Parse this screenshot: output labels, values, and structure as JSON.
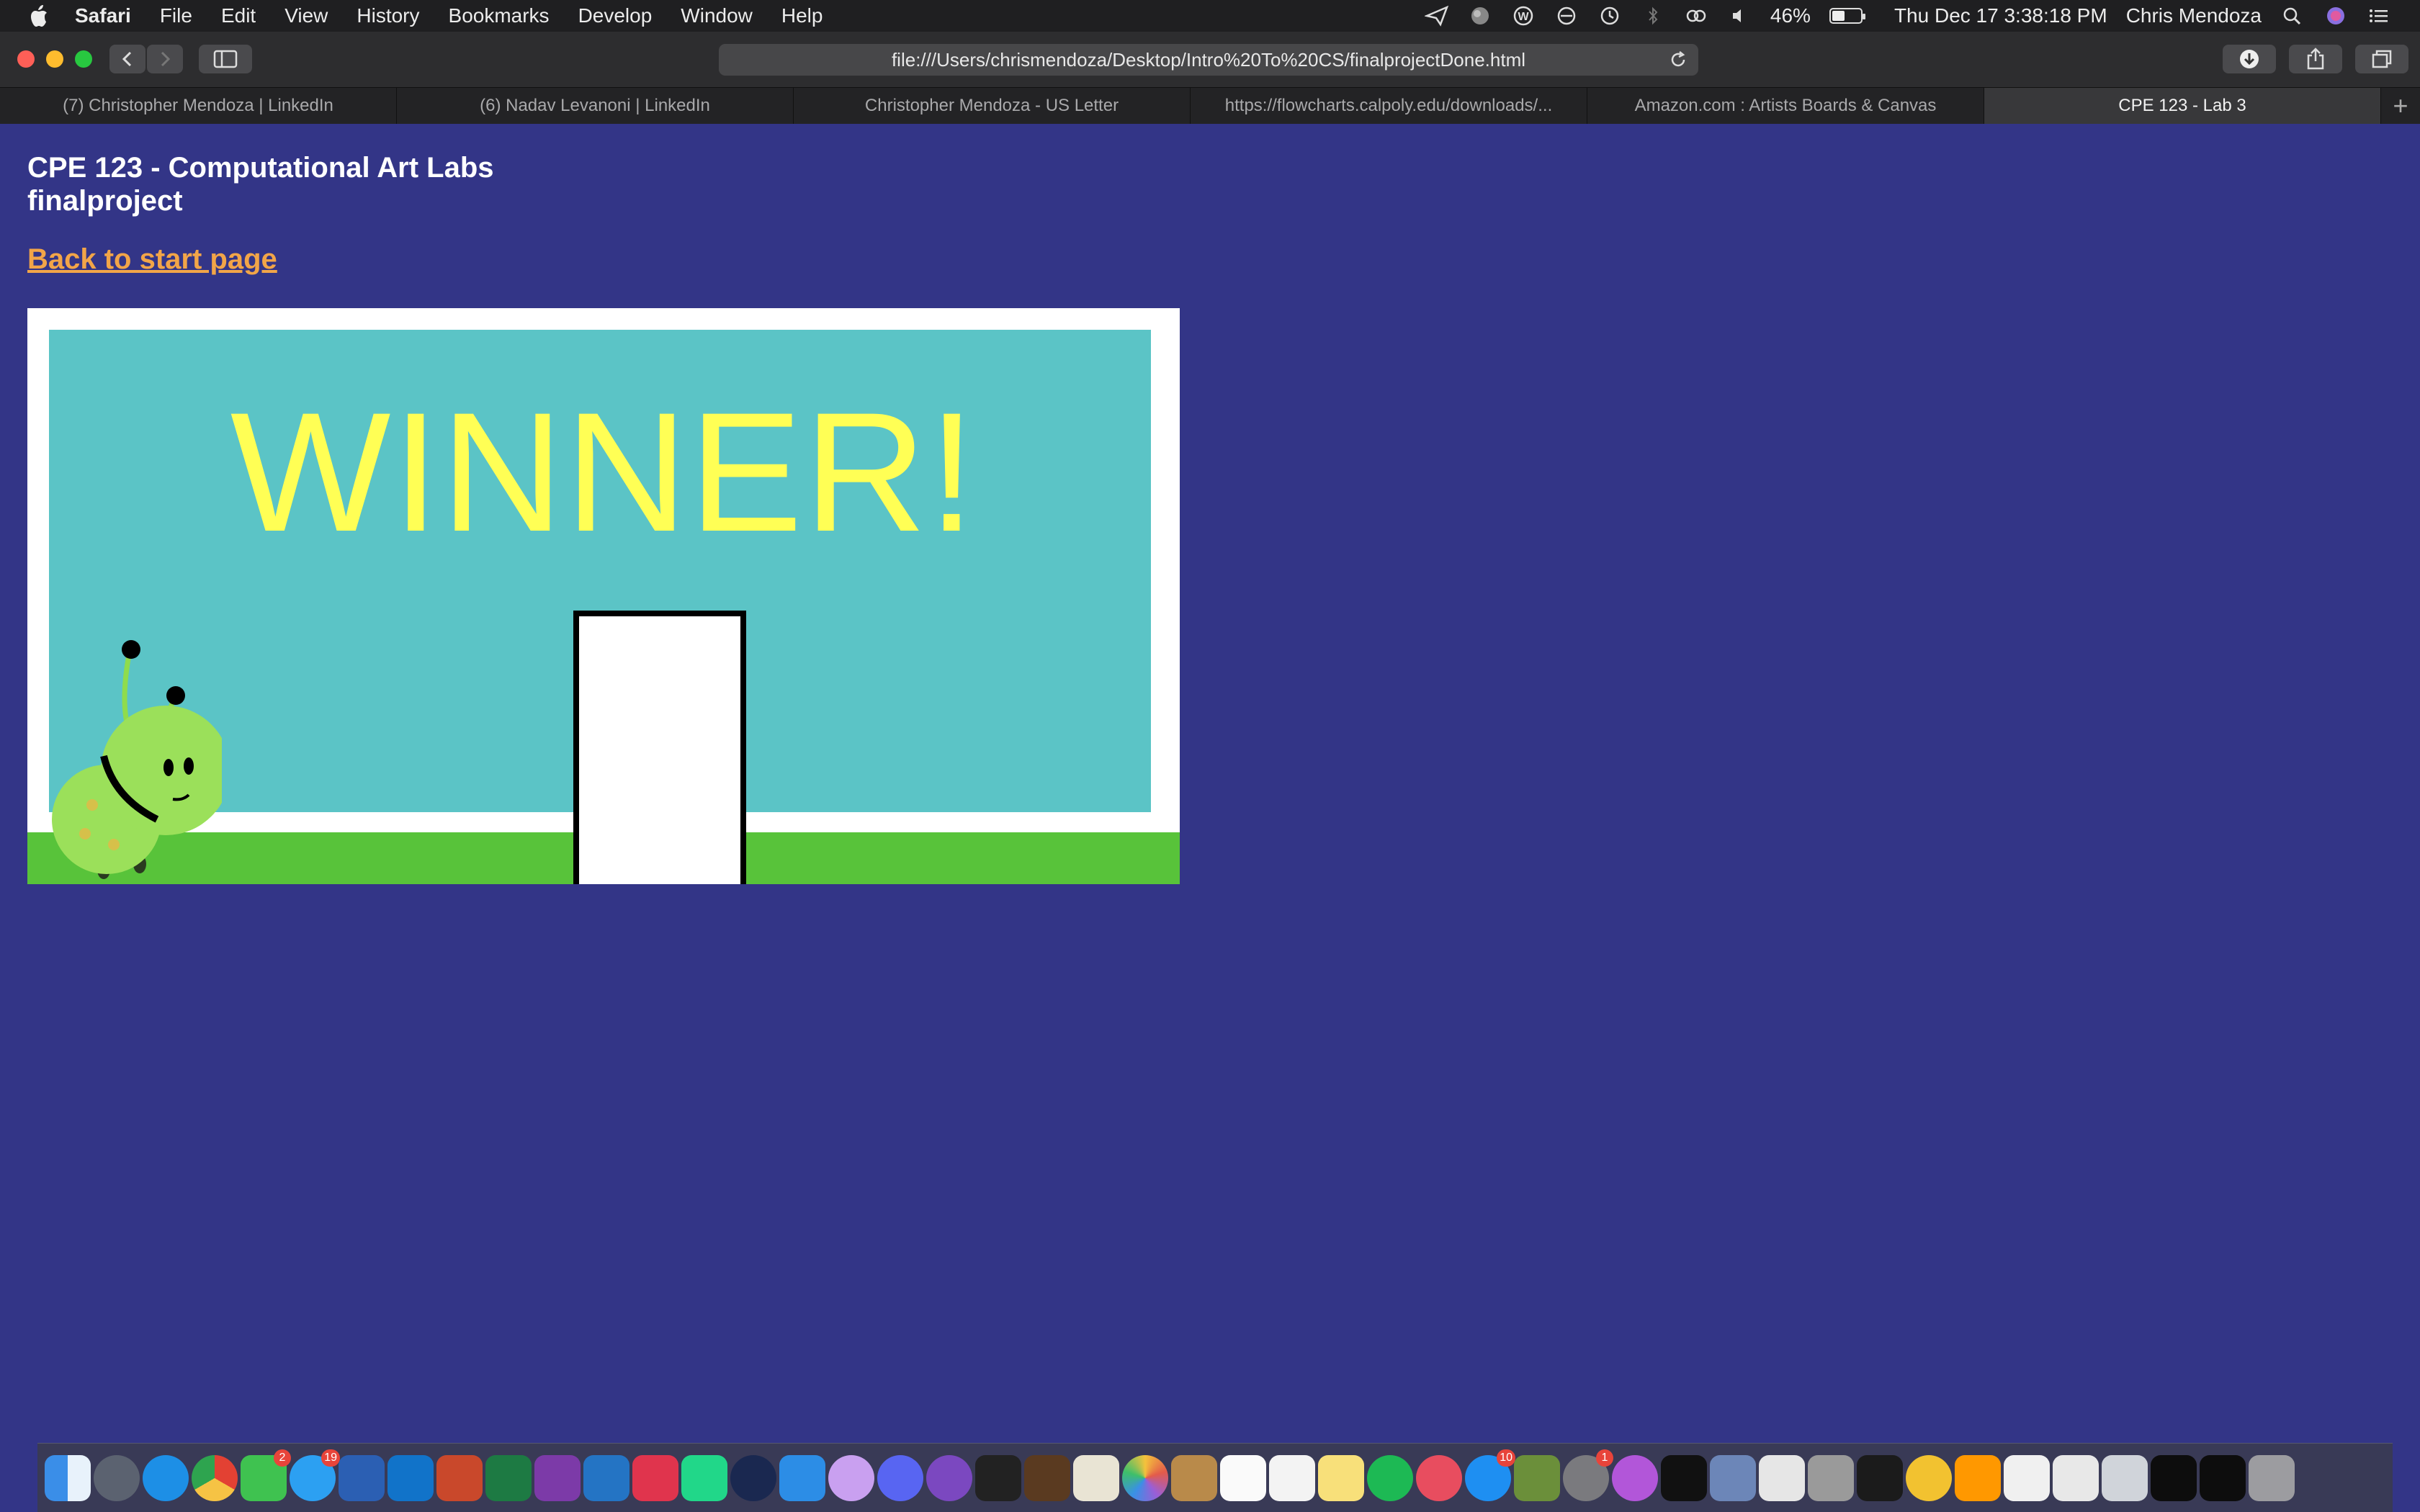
{
  "menubar": {
    "app": "Safari",
    "items": [
      "File",
      "Edit",
      "View",
      "History",
      "Bookmarks",
      "Develop",
      "Window",
      "Help"
    ],
    "battery": "46%",
    "battery_level": 0.46,
    "datetime": "Thu Dec 17  3:38:18 PM",
    "user": "Chris Mendoza"
  },
  "toolbar": {
    "url": "file:///Users/chrismendoza/Desktop/Intro%20To%20CS/finalprojectDone.html"
  },
  "tabs": [
    {
      "label": "(7) Christopher Mendoza | LinkedIn"
    },
    {
      "label": "(6) Nadav Levanoni | LinkedIn"
    },
    {
      "label": "Christopher Mendoza - US Letter"
    },
    {
      "label": "https://flowcharts.calpoly.edu/downloads/..."
    },
    {
      "label": "Amazon.com : Artists Boards & Canvas"
    },
    {
      "label": "CPE 123 - Lab 3"
    }
  ],
  "page": {
    "title_line1": "CPE 123 - Computational Art Labs",
    "title_line2": "finalproject",
    "back_link": "Back to start page",
    "canvas_text": "WINNER!"
  },
  "colors": {
    "page_bg": "#333587",
    "link": "#f2a548",
    "sky": "#5bc4c6",
    "grass": "#58c33a",
    "winner_text": "#ffff55"
  },
  "dock": {
    "badges": {
      "facetime": "2",
      "messages": "19",
      "appstore": "10",
      "system_prefs": "1"
    }
  }
}
